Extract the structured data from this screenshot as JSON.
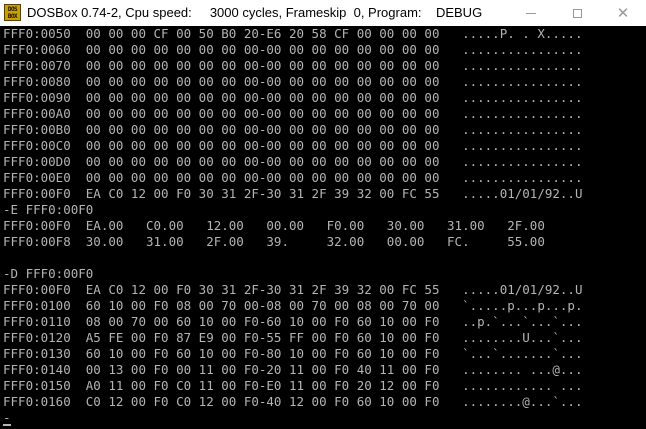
{
  "window": {
    "icon_text": "DOS BOX",
    "title": "DOSBox 0.74-2, Cpu speed:     3000 cycles, Frameskip  0, Program:    DEBUG",
    "minimize_icon": "minimize-icon",
    "maximize_icon": "maximize-icon",
    "close_icon": "close-icon",
    "close_glyph": "✕"
  },
  "console": {
    "fg_color": "#b4b4b4",
    "bg_color": "#000000",
    "lines": [
      "FFF0:0050  00 00 00 CF 00 50 B0 20-E6 20 58 CF 00 00 00 00   .....P. . X.....",
      "FFF0:0060  00 00 00 00 00 00 00 00-00 00 00 00 00 00 00 00   ................",
      "FFF0:0070  00 00 00 00 00 00 00 00-00 00 00 00 00 00 00 00   ................",
      "FFF0:0080  00 00 00 00 00 00 00 00-00 00 00 00 00 00 00 00   ................",
      "FFF0:0090  00 00 00 00 00 00 00 00-00 00 00 00 00 00 00 00   ................",
      "FFF0:00A0  00 00 00 00 00 00 00 00-00 00 00 00 00 00 00 00   ................",
      "FFF0:00B0  00 00 00 00 00 00 00 00-00 00 00 00 00 00 00 00   ................",
      "FFF0:00C0  00 00 00 00 00 00 00 00-00 00 00 00 00 00 00 00   ................",
      "FFF0:00D0  00 00 00 00 00 00 00 00-00 00 00 00 00 00 00 00   ................",
      "FFF0:00E0  00 00 00 00 00 00 00 00-00 00 00 00 00 00 00 00   ................",
      "FFF0:00F0  EA C0 12 00 F0 30 31 2F-30 31 2F 39 32 00 FC 55   .....01/01/92..U",
      "-E FFF0:00F0",
      "FFF0:00F0  EA.00   C0.00   12.00   00.00   F0.00   30.00   31.00   2F.00",
      "FFF0:00F8  30.00   31.00   2F.00   39.     32.00   00.00   FC.     55.00",
      "",
      "-D FFF0:00F0",
      "FFF0:00F0  EA C0 12 00 F0 30 31 2F-30 31 2F 39 32 00 FC 55   .....01/01/92..U",
      "FFF0:0100  60 10 00 F0 08 00 70 00-08 00 70 00 08 00 70 00   `.....p...p...p.",
      "FFF0:0110  08 00 70 00 60 10 00 F0-60 10 00 F0 60 10 00 F0   ..p.`...`...`...",
      "FFF0:0120  A5 FE 00 F0 87 E9 00 F0-55 FF 00 F0 60 10 00 F0   ........U...`...",
      "FFF0:0130  60 10 00 F0 60 10 00 F0-80 10 00 F0 60 10 00 F0   `...`.......`...",
      "FFF0:0140  00 13 00 F0 00 11 00 F0-20 11 00 F0 40 11 00 F0   ........ ...@...",
      "FFF0:0150  A0 11 00 F0 C0 11 00 F0-E0 11 00 F0 20 12 00 F0   ............ ...",
      "FFF0:0160  C0 12 00 F0 C0 12 00 F0-40 12 00 F0 60 10 00 F0   ........@...`..."
    ],
    "prompt": "-"
  }
}
